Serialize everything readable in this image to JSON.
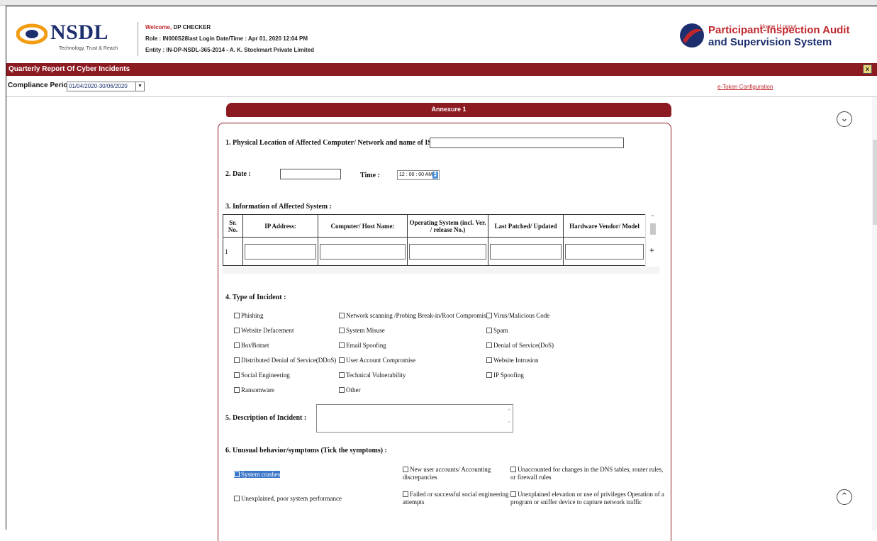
{
  "header": {
    "brand": "NSDL",
    "tagline": "Technology, Trust & Reach",
    "welcome_label": "Welcome,",
    "welcome_user": "DP CHECKER",
    "role_line": "Role : IN000S28last Login Date/Time : Apr 01, 2020 12:04 PM",
    "entity_line": "Entity : IN-DP-NSDL-365-2014 - A. K. Stockmart Private Limited",
    "system_title_line1": "Participant-Inspection Audit",
    "system_title_line2": "and Supervision System",
    "home_link": "Home",
    "logout_link": "Logout"
  },
  "report_bar": {
    "title": "Quarterly Report Of Cyber Incidents",
    "close_label": "x"
  },
  "compliance": {
    "label": "Compliance Period :",
    "selected": "01/04/2020-30/06/2020",
    "etoken_link": "e-Token Configuration"
  },
  "annexure": {
    "title": "Annexure 1",
    "q1_label": "1. Physical Location of Affected Computer/ Network and name of ISP :",
    "q2_date_label": "2.  Date :",
    "q2_time_label": "Time :",
    "q2_time_value": "12 : 00 : 00 AM",
    "q3_label": "3. Information of Affected System :",
    "table": {
      "headers": [
        "Sr. No.",
        "IP Address:",
        "Computer/ Host Name:",
        "Operating System (incl. Ver. / release No.)",
        "Last Patched/ Updated",
        "Hardware Vendor/ Model"
      ],
      "row_number": "1",
      "add_label": "+"
    },
    "q4_label": "4. Type of Incident :",
    "incident_types": [
      "Phishing",
      "Network scanning /Probing Break-in/Root Compromise",
      "Virus/Malicious Code",
      "Website Defacement",
      "System Misuse",
      "Spam",
      "Bot/Botnet",
      "Email Spoofing",
      "Denial of Service(DoS)",
      "Distributed Denial of Service(DDoS)",
      "User Account Compromise",
      "Website Intrusion",
      "Social Engineering",
      "Technical Vulnerability",
      "IP Spoofing",
      "Ransomware",
      "Other"
    ],
    "q5_label": "5. Description of Incident :",
    "q6_label": "6. Unusual behavior/symptoms (Tick the symptoms) :",
    "symptoms": [
      "System crashes",
      "New user accounts/ Accounting discrepancies",
      "Unaccounted for changes in the DNS tables, router rules, or firewall rules",
      "Unexplained, poor system performance",
      "Failed or successful social engineering attempts",
      "Unexplained elevation or use of privileges Operation of a program or sniffer device to capture network traffic"
    ]
  },
  "icons": {
    "scroll_down": "circle-chevron-down-icon",
    "scroll_up": "circle-chevron-up-icon"
  }
}
